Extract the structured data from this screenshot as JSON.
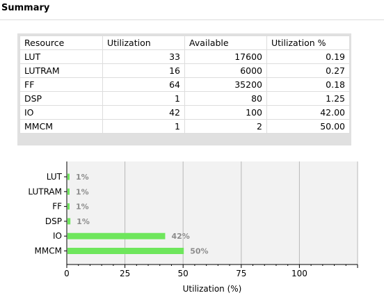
{
  "summary": {
    "title": "Summary"
  },
  "table": {
    "headers": [
      "Resource",
      "Utilization",
      "Available",
      "Utilization %"
    ],
    "rows": [
      [
        "LUT",
        "33",
        "17600",
        "0.19"
      ],
      [
        "LUTRAM",
        "16",
        "6000",
        "0.27"
      ],
      [
        "FF",
        "64",
        "35200",
        "0.18"
      ],
      [
        "DSP",
        "1",
        "80",
        "1.25"
      ],
      [
        "IO",
        "42",
        "100",
        "42.00"
      ],
      [
        "MMCM",
        "1",
        "2",
        "50.00"
      ]
    ]
  },
  "chart_data": {
    "type": "bar",
    "orientation": "horizontal",
    "categories": [
      "LUT",
      "LUTRAM",
      "FF",
      "DSP",
      "IO",
      "MMCM"
    ],
    "values": [
      0.19,
      0.27,
      0.18,
      1.25,
      42.0,
      50.0
    ],
    "value_labels": [
      "1%",
      "1%",
      "1%",
      "1%",
      "42%",
      "50%"
    ],
    "xlabel": "Utilization (%)",
    "ylabel": "",
    "xlim": [
      0,
      125
    ],
    "xticks": [
      0,
      25,
      50,
      75,
      100
    ],
    "grid": true,
    "colors": {
      "bar": "#6ee65c",
      "plot_background": "#f2f2f2",
      "grid": "#b8b8b8",
      "value_label": "#8c8c8c"
    }
  }
}
